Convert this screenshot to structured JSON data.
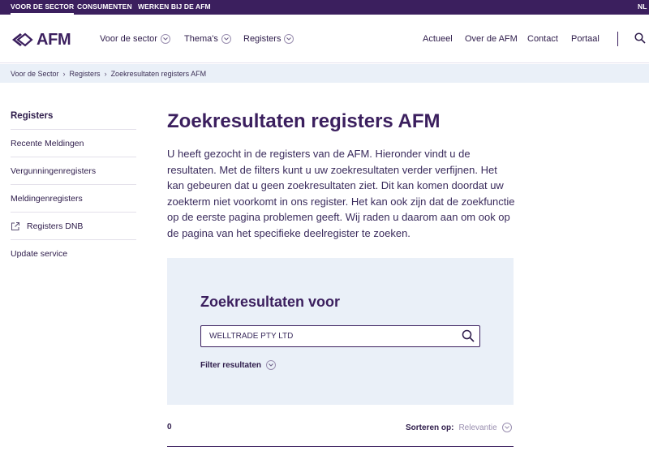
{
  "topbar": {
    "links": [
      "VOOR DE SECTOR",
      "CONSUMENTEN",
      "WERKEN BIJ DE AFM"
    ],
    "language": "NL"
  },
  "header": {
    "logo_text": "AFM",
    "nav_left": [
      "Voor de sector",
      "Thema's",
      "Registers"
    ],
    "nav_right": [
      "Actueel",
      "Over de AFM",
      "Contact",
      "Portaal"
    ]
  },
  "breadcrumb": [
    "Voor de Sector",
    "Registers",
    "Zoekresultaten registers AFM"
  ],
  "sidebar": {
    "items": [
      "Registers",
      "Recente Meldingen",
      "Vergunningenregisters",
      "Meldingenregisters",
      "Registers DNB",
      "Update service"
    ]
  },
  "main": {
    "title": "Zoekresultaten registers AFM",
    "intro": "U heeft gezocht in de registers van de AFM. Hieronder vindt u de resultaten. Met de filters kunt u uw zoekresultaten verder verfijnen. Het kan gebeuren dat u geen zoekresultaten ziet. Dit kan komen doordat uw zoekterm niet voorkomt in ons register. Het kan ook zijn dat de zoekfunctie op de eerste pagina problemen geeft. Wij raden u daarom aan om ook op de pagina van het specifieke deelregister te zoeken."
  },
  "search_panel": {
    "title": "Zoekresultaten voor",
    "query": "WELLTRADE PTY LTD",
    "filter_label": "Filter resultaten"
  },
  "results": {
    "count": "0",
    "sort_label": "Sorteren op:",
    "sort_value": "Relevantie"
  },
  "colors": {
    "brand": "#3b1f5e",
    "panel_bg": "#eaf0f8"
  }
}
